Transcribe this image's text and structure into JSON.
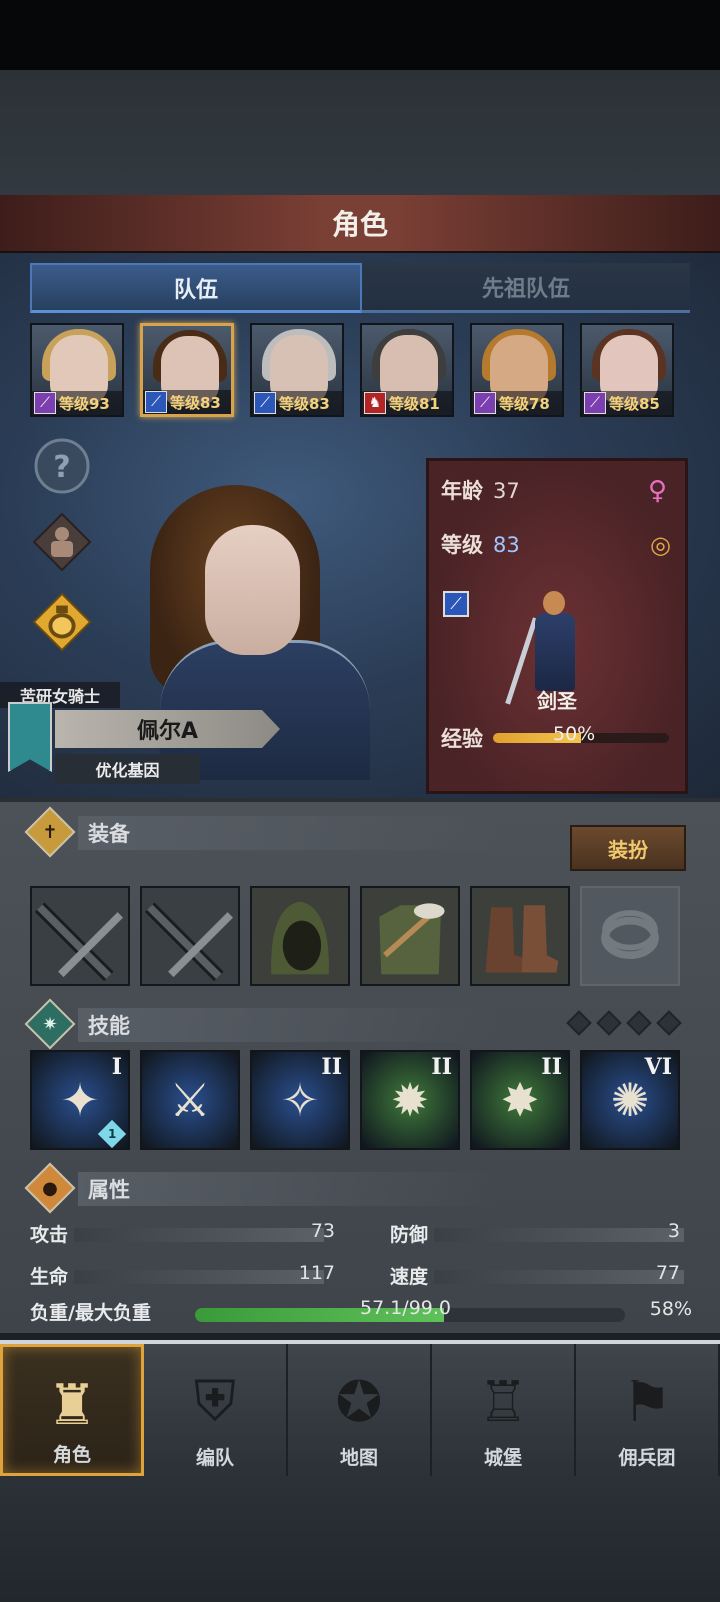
{
  "header": {
    "title": "角色"
  },
  "tabs": [
    {
      "label": "队伍",
      "active": true
    },
    {
      "label": "先祖队伍",
      "active": false
    }
  ],
  "level_prefix": "等级",
  "portraits": [
    {
      "level": "93",
      "class_icon": "staff-icon",
      "class_color": "#7b3fb0",
      "skin": "#e2c8b8",
      "hair": "#c8a25a"
    },
    {
      "level": "83",
      "class_icon": "sword-icon",
      "class_color": "#2b57b8",
      "skin": "#dcc3b5",
      "hair": "#4a2c16",
      "selected": true
    },
    {
      "level": "83",
      "class_icon": "sword-icon",
      "class_color": "#2b57b8",
      "skin": "#d7c0b4",
      "hair": "#bdbdbd"
    },
    {
      "level": "81",
      "class_icon": "bull-icon",
      "class_color": "#b22525",
      "skin": "#d8beb0",
      "hair": "#3e3e3e"
    },
    {
      "level": "78",
      "class_icon": "staff-icon",
      "class_color": "#7b3fb0",
      "skin": "#d6a985",
      "hair": "#b57a2e"
    },
    {
      "level": "85",
      "class_icon": "staff-icon",
      "class_color": "#7b3fb0",
      "skin": "#e2c6bd",
      "hair": "#5a3322"
    }
  ],
  "side_icons": [
    "help-icon",
    "armor-icon",
    "potion-icon"
  ],
  "character": {
    "class_title": "苦研女骑士",
    "name": "佩尔A",
    "gene": "优化基因",
    "age_label": "年龄",
    "age": "37",
    "level_label": "等级",
    "level": "83",
    "job": "剑圣",
    "exp_label": "经验",
    "exp_percent": "50%",
    "exp_value": 0.5
  },
  "equipment": {
    "label": "装备",
    "dress_button": "装扮",
    "slots": [
      "weapon-slot-1",
      "weapon-slot-2",
      "hood",
      "armor",
      "boots",
      "ring-empty"
    ]
  },
  "skills": {
    "label": "技能",
    "items": [
      {
        "rank": "I",
        "color": "#2a4f8f",
        "glyph": "✦",
        "gem": "1"
      },
      {
        "rank": "",
        "color": "#2a4f8f",
        "glyph": "⚔"
      },
      {
        "rank": "II",
        "color": "#2a4f8f",
        "glyph": "✧"
      },
      {
        "rank": "II",
        "color": "#3f7a3a",
        "glyph": "✹"
      },
      {
        "rank": "II",
        "color": "#3f7a3a",
        "glyph": "✸"
      },
      {
        "rank": "VI",
        "color": "#2a4f8f",
        "glyph": "✺"
      }
    ]
  },
  "attributes": {
    "label": "属性",
    "attack_label": "攻击",
    "attack": "73",
    "defense_label": "防御",
    "defense": "3",
    "hp_label": "生命",
    "hp": "117",
    "speed_label": "速度",
    "speed": "77",
    "load_label": "负重/最大负重",
    "load_text": "57.1/99.0",
    "load_percent": "58%",
    "load_value": 0.58
  },
  "nav": [
    {
      "label": "角色",
      "icon": "knight-icon",
      "active": true
    },
    {
      "label": "编队",
      "icon": "formation-icon",
      "active": false
    },
    {
      "label": "地图",
      "icon": "map-icon",
      "active": false
    },
    {
      "label": "城堡",
      "icon": "castle-icon",
      "active": false
    },
    {
      "label": "佣兵团",
      "icon": "mercenary-icon",
      "active": false
    }
  ]
}
